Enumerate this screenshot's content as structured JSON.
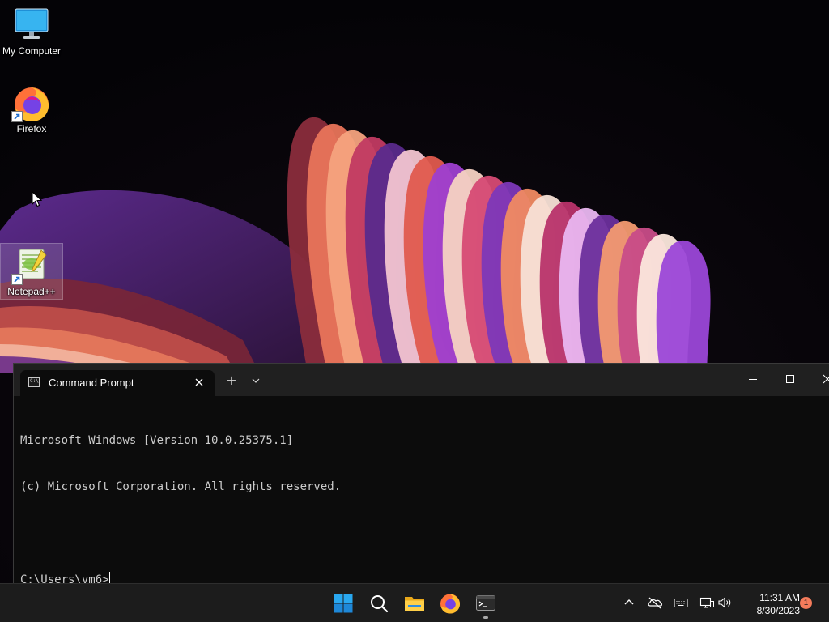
{
  "desktop": {
    "icons": [
      {
        "label": "My Computer",
        "icon": "monitor-icon"
      },
      {
        "label": "Firefox",
        "icon": "firefox-icon"
      },
      {
        "label": "Notepad++",
        "icon": "notepadpp-icon"
      }
    ]
  },
  "terminal": {
    "tab_title": "Command Prompt",
    "tab_icon_text": "C:\\",
    "new_tab_symbol": "+",
    "console_lines": [
      "Microsoft Windows [Version 10.0.25375.1]",
      "(c) Microsoft Corporation. All rights reserved.",
      "",
      "C:\\Users\\vm6>"
    ]
  },
  "taskbar": {
    "apps": [
      {
        "name": "start",
        "icon": "windows-logo-icon"
      },
      {
        "name": "search",
        "icon": "search-icon"
      },
      {
        "name": "file-explorer",
        "icon": "folder-icon"
      },
      {
        "name": "firefox",
        "icon": "firefox-icon"
      },
      {
        "name": "terminal",
        "icon": "terminal-icon",
        "running": true
      }
    ],
    "tray": {
      "time": "11:31 AM",
      "date": "8/30/2023",
      "notification_count": "1"
    }
  },
  "colors": {
    "accent": "#0078d4",
    "taskbar_bg": "#1c1c1c",
    "console_bg": "#0c0c0c",
    "titlebar_bg": "#202020",
    "badge": "#f47b5b"
  }
}
